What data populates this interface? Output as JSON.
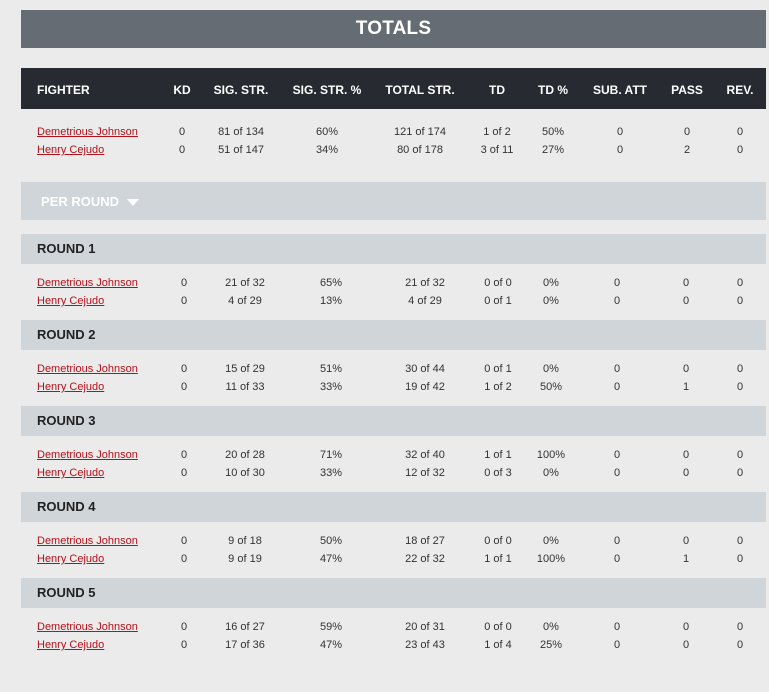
{
  "totals": {
    "title": "TOTALS",
    "columns": [
      "FIGHTER",
      "KD",
      "SIG. STR.",
      "SIG. STR. %",
      "TOTAL STR.",
      "TD",
      "TD %",
      "SUB. ATT",
      "PASS",
      "REV."
    ],
    "rows": [
      [
        "Demetrious Johnson",
        "0",
        "81 of 134",
        "60%",
        "121 of 174",
        "1 of 2",
        "50%",
        "0",
        "0",
        "0"
      ],
      [
        "Henry Cejudo",
        "0",
        "51 of 147",
        "34%",
        "80 of 178",
        "3 of 11",
        "27%",
        "0",
        "2",
        "0"
      ]
    ]
  },
  "per_round": {
    "label": "PER ROUND",
    "rounds": [
      {
        "title": "ROUND 1",
        "rows": [
          [
            "Demetrious Johnson",
            "0",
            "21 of 32",
            "65%",
            "21 of 32",
            "0 of 0",
            "0%",
            "0",
            "0",
            "0"
          ],
          [
            "Henry Cejudo",
            "0",
            "4 of 29",
            "13%",
            "4 of 29",
            "0 of 1",
            "0%",
            "0",
            "0",
            "0"
          ]
        ]
      },
      {
        "title": "ROUND 2",
        "rows": [
          [
            "Demetrious Johnson",
            "0",
            "15 of 29",
            "51%",
            "30 of 44",
            "0 of 1",
            "0%",
            "0",
            "0",
            "0"
          ],
          [
            "Henry Cejudo",
            "0",
            "11 of 33",
            "33%",
            "19 of 42",
            "1 of 2",
            "50%",
            "0",
            "1",
            "0"
          ]
        ]
      },
      {
        "title": "ROUND 3",
        "rows": [
          [
            "Demetrious Johnson",
            "0",
            "20 of 28",
            "71%",
            "32 of 40",
            "1 of 1",
            "100%",
            "0",
            "0",
            "0"
          ],
          [
            "Henry Cejudo",
            "0",
            "10 of 30",
            "33%",
            "12 of 32",
            "0 of 3",
            "0%",
            "0",
            "0",
            "0"
          ]
        ]
      },
      {
        "title": "ROUND 4",
        "rows": [
          [
            "Demetrious Johnson",
            "0",
            "9 of 18",
            "50%",
            "18 of 27",
            "0 of 0",
            "0%",
            "0",
            "0",
            "0"
          ],
          [
            "Henry Cejudo",
            "0",
            "9 of 19",
            "47%",
            "22 of 32",
            "1 of 1",
            "100%",
            "0",
            "1",
            "0"
          ]
        ]
      },
      {
        "title": "ROUND 5",
        "rows": [
          [
            "Demetrious Johnson",
            "0",
            "16 of 27",
            "59%",
            "20 of 31",
            "0 of 0",
            "0%",
            "0",
            "0",
            "0"
          ],
          [
            "Henry Cejudo",
            "0",
            "17 of 36",
            "47%",
            "23 of 43",
            "1 of 4",
            "25%",
            "0",
            "0",
            "0"
          ]
        ]
      }
    ]
  },
  "colors": {
    "banner": "#666c73",
    "header": "#272b31",
    "section": "#d0d5da",
    "link": "#b3121b",
    "page": "#ebebeb"
  },
  "icons": {
    "per_round_toggle": "chevron-down-icon"
  }
}
